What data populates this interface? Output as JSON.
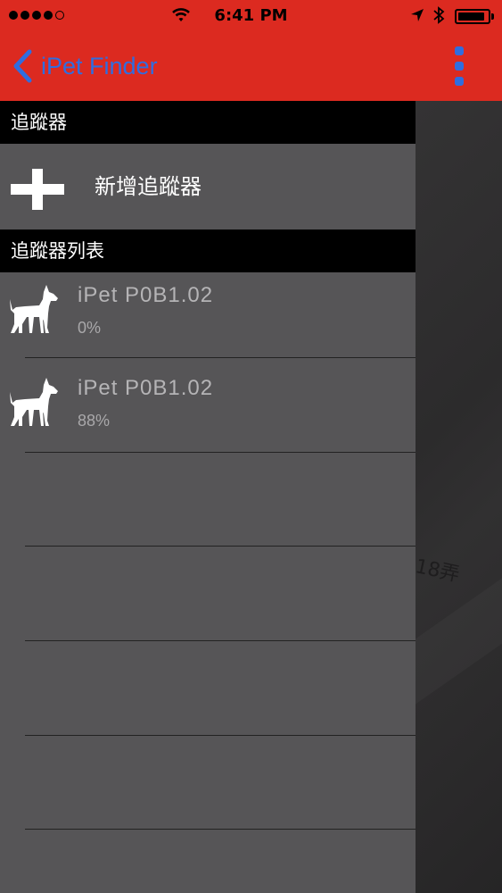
{
  "status_bar": {
    "time": "6:41 PM",
    "signal_dots_filled": 4,
    "signal_dots_total": 5,
    "battery_level": 0.9
  },
  "nav": {
    "back_label": "iPet Finder",
    "accent_color": "#2f6de0",
    "bar_color": "#dc2a20"
  },
  "drawer": {
    "section_tracker": "追蹤器",
    "add_tracker_label": "新增追蹤器",
    "section_list": "追蹤器列表",
    "trackers": [
      {
        "name": "iPet  P0B1.02",
        "battery": "0%"
      },
      {
        "name": "iPet  P0B1.02",
        "battery": "88%"
      }
    ]
  },
  "map": {
    "label": "18弄"
  },
  "icons": [
    "back-chevron-icon",
    "menu-dots-icon",
    "plus-icon",
    "dog-icon",
    "wifi-icon",
    "location-arrow-icon",
    "bluetooth-icon",
    "battery-icon"
  ]
}
